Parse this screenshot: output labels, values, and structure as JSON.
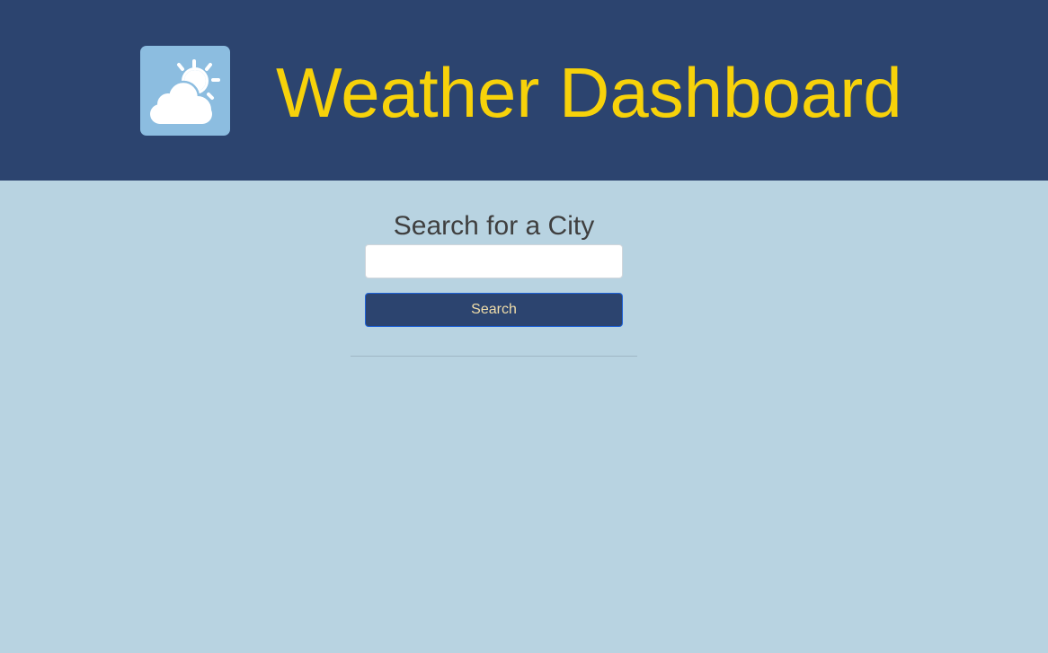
{
  "header": {
    "title": "Weather Dashboard",
    "logo_icon": "partly-cloudy-icon"
  },
  "search": {
    "heading": "Search for a City",
    "input_value": "",
    "input_placeholder": "",
    "button_label": "Search"
  },
  "colors": {
    "header_background": "#2c446f",
    "page_background": "#b8d3e1",
    "title": "#f7d20a",
    "logo_background": "#8cbde0",
    "button_background": "#2c446f",
    "button_text": "#f1deaa",
    "button_border": "#1f63d8"
  }
}
